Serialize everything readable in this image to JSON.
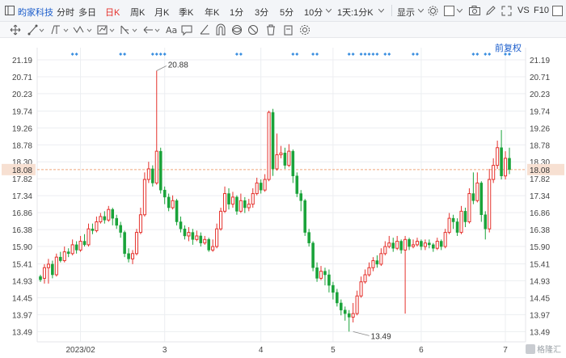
{
  "toolbar": {
    "stock_name": "昀家科技",
    "periods": [
      "分时",
      "多日",
      "日K",
      "周K",
      "月K",
      "季K",
      "年K",
      "1分",
      "3分",
      "5分",
      "10分",
      "1天:1分K"
    ],
    "active_period": "日K",
    "display_label": "显示",
    "f10_label": "F10"
  },
  "chart_header": {
    "restore_label": "前复权"
  },
  "watermark": {
    "text": "格隆汇"
  },
  "colors": {
    "up": "#e5322d",
    "down": "#1aa33a",
    "last_price_line": "#f0a87c",
    "marker": "#3b8fe0",
    "last_price_bg": "#f7e0d2"
  },
  "chart_data": {
    "type": "candlestick",
    "y_ticks": [
      "21.19",
      "20.71",
      "20.23",
      "19.74",
      "19.26",
      "18.78",
      "18.30",
      "17.82",
      "17.34",
      "16.86",
      "16.38",
      "15.90",
      "15.41",
      "14.93",
      "14.45",
      "13.97",
      "13.49"
    ],
    "y_range": [
      13.2,
      21.35
    ],
    "x_ticks": [
      {
        "label": "2023/02",
        "index": 10
      },
      {
        "label": "3",
        "index": 31
      },
      {
        "label": "4",
        "index": 55
      },
      {
        "label": "5",
        "index": 73
      },
      {
        "label": "6",
        "index": 95
      },
      {
        "label": "7",
        "index": 116
      }
    ],
    "last_price": "18.08",
    "high_annotation": {
      "text": "20.88",
      "index": 29,
      "value": 20.88
    },
    "low_annotation": {
      "text": "13.49",
      "index": 78,
      "value": 13.49
    },
    "event_markers": [
      8,
      9,
      20,
      21,
      28,
      29,
      30,
      31,
      49,
      50,
      63,
      64,
      68,
      69,
      77,
      78,
      80,
      81,
      82,
      83,
      84,
      86,
      87,
      93,
      94,
      108,
      109,
      111,
      112,
      116,
      117
    ],
    "grid": true,
    "candles": [
      [
        15.05,
        14.96,
        15.1,
        14.9
      ],
      [
        15.0,
        15.3,
        15.4,
        14.85
      ],
      [
        15.3,
        15.4,
        15.55,
        14.85
      ],
      [
        15.4,
        15.1,
        15.5,
        15.0
      ],
      [
        15.1,
        15.6,
        15.7,
        15.05
      ],
      [
        15.6,
        15.5,
        15.75,
        15.45
      ],
      [
        15.5,
        15.75,
        15.9,
        15.45
      ],
      [
        15.75,
        15.7,
        15.85,
        15.6
      ],
      [
        15.7,
        15.95,
        16.1,
        15.65
      ],
      [
        15.95,
        15.8,
        16.05,
        15.7
      ],
      [
        15.8,
        16.05,
        16.2,
        15.75
      ],
      [
        16.05,
        15.95,
        16.25,
        15.9
      ],
      [
        15.95,
        16.4,
        16.55,
        15.9
      ],
      [
        16.4,
        16.35,
        16.55,
        16.25
      ],
      [
        16.35,
        16.6,
        16.75,
        16.3
      ],
      [
        16.6,
        16.75,
        16.85,
        16.55
      ],
      [
        16.75,
        16.65,
        16.9,
        16.55
      ],
      [
        16.65,
        16.95,
        17.05,
        16.6
      ],
      [
        16.95,
        16.7,
        17.0,
        16.5
      ],
      [
        16.7,
        16.5,
        16.8,
        16.4
      ],
      [
        16.5,
        16.3,
        16.6,
        16.15
      ],
      [
        16.3,
        15.7,
        16.35,
        15.6
      ],
      [
        15.7,
        15.55,
        15.85,
        15.45
      ],
      [
        15.55,
        15.7,
        15.8,
        15.4
      ],
      [
        15.7,
        16.3,
        16.4,
        15.65
      ],
      [
        16.3,
        16.8,
        17.0,
        16.25
      ],
      [
        16.8,
        17.8,
        18.0,
        16.75
      ],
      [
        17.8,
        18.1,
        18.3,
        17.7
      ],
      [
        18.1,
        17.7,
        18.2,
        17.6
      ],
      [
        17.7,
        18.6,
        20.88,
        17.65
      ],
      [
        18.6,
        17.5,
        18.7,
        17.4
      ],
      [
        17.5,
        17.3,
        17.6,
        17.1
      ],
      [
        17.3,
        17.0,
        17.4,
        16.9
      ],
      [
        17.0,
        17.2,
        17.35,
        16.95
      ],
      [
        17.2,
        16.6,
        17.25,
        16.5
      ],
      [
        16.6,
        16.4,
        16.75,
        16.3
      ],
      [
        16.4,
        16.2,
        16.5,
        16.1
      ],
      [
        16.2,
        16.3,
        16.45,
        16.05
      ],
      [
        16.3,
        16.1,
        16.4,
        15.95
      ],
      [
        16.1,
        16.2,
        16.35,
        16.05
      ],
      [
        16.2,
        16.0,
        16.3,
        15.9
      ],
      [
        16.0,
        16.1,
        16.2,
        15.95
      ],
      [
        16.1,
        15.8,
        16.15,
        15.75
      ],
      [
        15.8,
        15.9,
        16.1,
        15.75
      ],
      [
        15.9,
        16.4,
        16.55,
        15.85
      ],
      [
        16.4,
        16.9,
        17.0,
        16.35
      ],
      [
        16.9,
        17.4,
        17.6,
        16.85
      ],
      [
        17.4,
        17.1,
        17.55,
        16.95
      ],
      [
        17.1,
        17.3,
        17.45,
        17.0
      ],
      [
        17.3,
        16.9,
        17.35,
        16.8
      ],
      [
        16.9,
        17.2,
        17.4,
        16.85
      ],
      [
        17.2,
        17.0,
        17.3,
        16.85
      ],
      [
        17.0,
        17.1,
        17.25,
        16.9
      ],
      [
        17.1,
        17.4,
        17.55,
        17.0
      ],
      [
        17.4,
        17.7,
        17.85,
        17.35
      ],
      [
        17.7,
        17.5,
        17.8,
        17.4
      ],
      [
        17.5,
        17.8,
        17.95,
        17.45
      ],
      [
        17.8,
        19.7,
        19.75,
        17.75
      ],
      [
        19.7,
        18.1,
        19.8,
        17.9
      ],
      [
        18.1,
        18.5,
        19.1,
        18.05
      ],
      [
        18.5,
        18.55,
        18.75,
        18.4
      ],
      [
        18.55,
        18.2,
        18.7,
        18.1
      ],
      [
        18.2,
        18.6,
        18.8,
        18.15
      ],
      [
        18.6,
        17.9,
        18.65,
        17.7
      ],
      [
        17.9,
        17.4,
        18.0,
        17.3
      ],
      [
        17.4,
        17.2,
        17.5,
        16.9
      ],
      [
        17.2,
        16.3,
        17.25,
        16.2
      ],
      [
        16.3,
        16.0,
        16.4,
        15.9
      ],
      [
        16.0,
        15.3,
        16.05,
        15.2
      ],
      [
        15.3,
        15.0,
        15.45,
        14.9
      ],
      [
        15.0,
        15.2,
        15.35,
        14.95
      ],
      [
        15.2,
        15.1,
        15.3,
        14.8
      ],
      [
        15.1,
        14.8,
        15.25,
        14.6
      ],
      [
        14.8,
        14.6,
        14.9,
        14.4
      ],
      [
        14.6,
        14.3,
        14.7,
        14.2
      ],
      [
        14.3,
        14.1,
        14.4,
        13.95
      ],
      [
        14.1,
        14.0,
        14.2,
        13.8
      ],
      [
        14.0,
        13.9,
        14.1,
        13.49
      ],
      [
        13.9,
        14.0,
        14.3,
        13.75
      ],
      [
        14.0,
        14.5,
        14.65,
        13.95
      ],
      [
        14.5,
        14.9,
        15.05,
        14.45
      ],
      [
        14.9,
        15.1,
        15.25,
        14.85
      ],
      [
        15.1,
        15.3,
        15.45,
        15.05
      ],
      [
        15.3,
        15.5,
        15.6,
        15.2
      ],
      [
        15.5,
        15.4,
        15.65,
        15.3
      ],
      [
        15.4,
        15.7,
        15.85,
        15.35
      ],
      [
        15.7,
        15.9,
        16.05,
        15.65
      ],
      [
        15.9,
        16.0,
        16.2,
        15.85
      ],
      [
        16.0,
        15.85,
        16.15,
        15.75
      ],
      [
        15.85,
        16.05,
        16.2,
        15.8
      ],
      [
        16.05,
        15.8,
        16.1,
        15.7
      ],
      [
        15.8,
        16.1,
        16.2,
        14.0
      ],
      [
        16.1,
        15.9,
        16.15,
        15.8
      ],
      [
        15.9,
        15.95,
        16.1,
        15.85
      ],
      [
        15.95,
        16.05,
        16.15,
        15.9
      ],
      [
        16.05,
        15.9,
        16.1,
        15.8
      ],
      [
        15.9,
        16.0,
        16.1,
        15.8
      ],
      [
        16.0,
        15.95,
        16.1,
        15.85
      ],
      [
        15.95,
        15.85,
        16.0,
        15.75
      ],
      [
        15.85,
        16.05,
        16.15,
        15.8
      ],
      [
        16.05,
        15.9,
        16.1,
        15.8
      ],
      [
        15.9,
        16.3,
        16.4,
        15.85
      ],
      [
        16.3,
        16.7,
        16.85,
        16.25
      ],
      [
        16.7,
        16.6,
        16.8,
        16.4
      ],
      [
        16.6,
        16.3,
        16.7,
        16.2
      ],
      [
        16.3,
        16.9,
        17.05,
        16.25
      ],
      [
        16.9,
        16.6,
        17.0,
        16.45
      ],
      [
        16.6,
        17.4,
        17.55,
        16.55
      ],
      [
        17.4,
        17.2,
        18.0,
        17.1
      ],
      [
        17.2,
        17.7,
        18.0,
        17.15
      ],
      [
        17.7,
        16.8,
        17.75,
        16.6
      ],
      [
        16.8,
        16.4,
        16.9,
        16.1
      ],
      [
        16.4,
        17.8,
        18.1,
        16.3
      ],
      [
        17.8,
        18.2,
        18.4,
        17.7
      ],
      [
        18.2,
        18.7,
        18.9,
        18.1
      ],
      [
        18.7,
        17.9,
        19.2,
        17.8
      ],
      [
        17.9,
        18.4,
        18.6,
        17.8
      ],
      [
        18.4,
        18.08,
        18.7,
        17.95
      ]
    ]
  }
}
